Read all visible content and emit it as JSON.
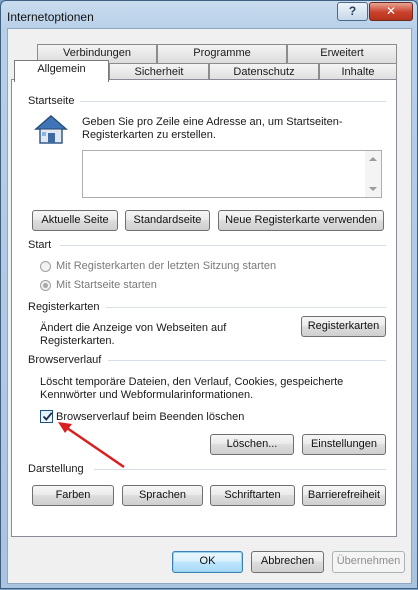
{
  "window": {
    "title": "Internetoptionen",
    "help_label": "?",
    "close_label": "✕"
  },
  "tabs_back": [
    {
      "label": "Verbindungen"
    },
    {
      "label": "Programme"
    },
    {
      "label": "Erweitert"
    }
  ],
  "tabs_front": [
    {
      "label": "Allgemein"
    },
    {
      "label": "Sicherheit"
    },
    {
      "label": "Datenschutz"
    },
    {
      "label": "Inhalte"
    }
  ],
  "startseite": {
    "label": "Startseite",
    "description": "Geben Sie pro Zeile eine Adresse an, um Startseiten-Registerkarten zu erstellen.",
    "value": "",
    "buttons": {
      "current": "Aktuelle Seite",
      "default": "Standardseite",
      "new_tab": "Neue Registerkarte verwenden"
    }
  },
  "start": {
    "label": "Start",
    "option_last_session": "Mit Registerkarten der letzten Sitzung starten",
    "option_homepage": "Mit Startseite starten"
  },
  "registerkarten": {
    "label": "Registerkarten",
    "description": "Ändert die Anzeige von Webseiten auf Registerkarten.",
    "button": "Registerkarten"
  },
  "browserverlauf": {
    "label": "Browserverlauf",
    "description": "Löscht temporäre Dateien, den Verlauf, Cookies, gespeicherte Kennwörter und Webformularinformationen.",
    "checkbox_label": "Browserverlauf beim Beenden löschen",
    "delete_button": "Löschen...",
    "settings_button": "Einstellungen"
  },
  "darstellung": {
    "label": "Darstellung",
    "buttons": [
      "Farben",
      "Sprachen",
      "Schriftarten",
      "Barrierefreiheit"
    ]
  },
  "footer": {
    "ok": "OK",
    "cancel": "Abbrechen",
    "apply": "Übernehmen"
  },
  "colors": {
    "annotation_arrow": "#d81e1e",
    "selection_blue": "#1c5180"
  }
}
